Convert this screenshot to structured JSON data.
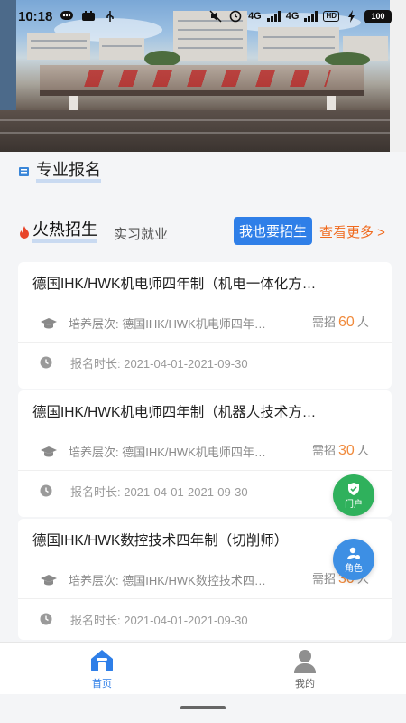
{
  "status_bar": {
    "time": "10:18",
    "battery": "100",
    "network_a": "4G",
    "network_b": "4G",
    "hd": "HD"
  },
  "section": {
    "title": "专业报名"
  },
  "tabs": {
    "hot": "火热招生",
    "intern": "实习就业",
    "enroll_button": "我也要招生",
    "see_more": "查看更多 >"
  },
  "cards": [
    {
      "title": "德国IHK/HWK机电师四年制（机电一体化方…",
      "level": "培养层次: 德国IHK/HWK机电师四年…",
      "quota_prefix": "需招",
      "quota": "60",
      "quota_unit": "人",
      "period": "报名时长: 2021-04-01-2021-09-30"
    },
    {
      "title": "德国IHK/HWK机电师四年制（机器人技术方…",
      "level": "培养层次: 德国IHK/HWK机电师四年…",
      "quota_prefix": "需招",
      "quota": "30",
      "quota_unit": "人",
      "period": "报名时长: 2021-04-01-2021-09-30"
    },
    {
      "title": "德国IHK/HWK数控技术四年制（切削师）",
      "level": "培养层次: 德国IHK/HWK数控技术四…",
      "quota_prefix": "需招",
      "quota": "30",
      "quota_unit": "人",
      "period": "报名时长: 2021-04-01-2021-09-30"
    }
  ],
  "fabs": {
    "portal": "门户",
    "role": "角色"
  },
  "bottom_nav": {
    "home": "首页",
    "mine": "我的"
  },
  "colors": {
    "accent": "#2f7fe8",
    "orange": "#f06a1e",
    "portal_green": "#2fb15c",
    "role_blue": "#3d8fe4"
  }
}
